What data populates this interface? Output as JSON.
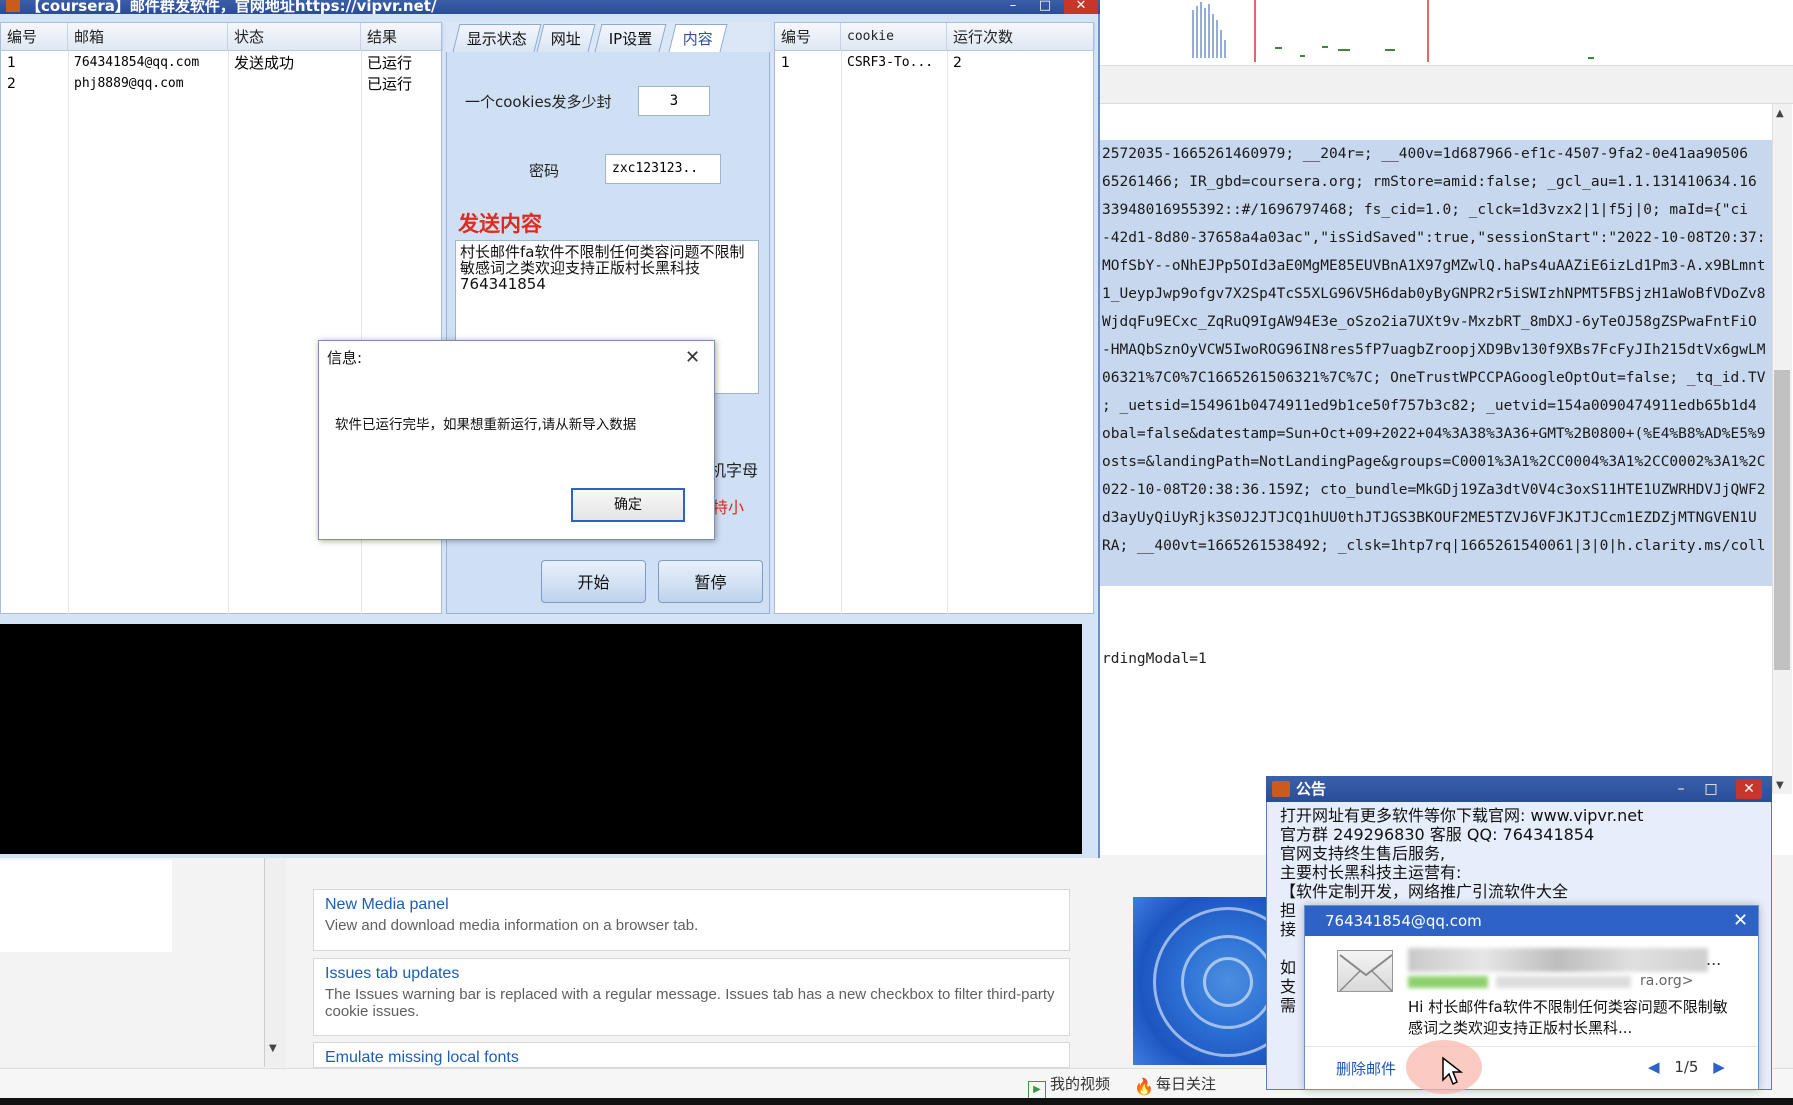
{
  "app": {
    "title": "【coursera】邮件群发软件，官网地址https://vipvr.net/",
    "minimize": "–",
    "maximize": "□",
    "close": "✕"
  },
  "left_table": {
    "headers": [
      "编号",
      "邮箱",
      "状态",
      "结果"
    ],
    "rows": [
      {
        "id": "1",
        "email": "764341854@qq.com",
        "status": "发送成功",
        "result": "已运行"
      },
      {
        "id": "2",
        "email": "phj8889@qq.com",
        "status": "",
        "result": "已运行"
      }
    ]
  },
  "tabs": [
    {
      "label": "显示状态",
      "active": false
    },
    {
      "label": "网址",
      "active": false
    },
    {
      "label": "IP设置",
      "active": false
    },
    {
      "label": "内容",
      "active": true
    }
  ],
  "content_tab": {
    "cookie_count_label": "一个cookies发多少封",
    "cookie_count_value": "3",
    "password_label": "密码",
    "password_value": "zxc123123..",
    "send_content_label": "发送内容",
    "send_content_text": "村长邮件fa软件不限制任何类容问题不限制敏感词之类欢迎支持正版村长黑科技\n764341854",
    "partial_label_1": "机字母",
    "partial_label_2": "特小",
    "start_button": "开始",
    "pause_button": "暂停"
  },
  "right_table": {
    "headers": [
      "编号",
      "cookie",
      "运行次数"
    ],
    "rows": [
      {
        "id": "1",
        "cookie": "CSRF3-To...",
        "count": "2"
      }
    ]
  },
  "modal": {
    "title": "信息:",
    "message": "软件已运行完毕，如果想重新运行,请从新导入数据",
    "ok_button": "确定",
    "close": "✕"
  },
  "cookie_lines": [
    "2572035-1665261460979; __204r=; __400v=1d687966-ef1c-4507-9fa2-0e41aa90506",
    "65261466; IR_gbd=coursera.org; rmStore=amid:false; _gcl_au=1.1.131410634.16",
    "33948016955392::#/1696797468; fs_cid=1.0; _clck=1d3vzx2|1|f5j|0; maId={\"ci",
    "-42d1-8d80-37658a4a03ac\",\"isSidSaved\":true,\"sessionStart\":\"2022-10-08T20:37:",
    "MOfSbY--oNhEJPp5OId3aE0MgME85EUVBnA1X97gMZwlQ.haPs4uAAZiE6izLd1Pm3-A.x9BLmnt",
    "1_UeypJwp9ofgv7X2Sp4TcS5XLG96V5H6dab0yByGNPR2r5iSWIzhNPMT5FBSjzH1aWoBfVDoZv8",
    "WjdqFu9ECxc_ZqRuQ9IgAW94E3e_oSzo2ia7UXt9v-MxzbRT_8mDXJ-6yTeOJ58gZSPwaFntFiO",
    "-HMAQbSznOyVCW5IwoROG96IN8res5fP7uagbZroopjXD9Bv130f9XBs7FcFyJIh215dtVx6gwLM",
    "06321%7C0%7C1665261506321%7C%7C; OneTrustWPCCPAGoogleOptOut=false; _tq_id.TV",
    "; _uetsid=154961b0474911ed9b1ce50f757b3c82; _uetvid=154a0090474911edb65b1d4",
    "obal=false&datestamp=Sun+Oct+09+2022+04%3A38%3A36+GMT%2B0800+(%E4%B8%AD%E5%9",
    "osts=&landingPath=NotLandingPage&groups=C0001%3A1%2CC0004%3A1%2CC0002%3A1%2C",
    "022-10-08T20:38:36.159Z; cto_bundle=MkGDj19Za3dtV0V4c3oxS11HTE1UZWRHDVJjQWF2",
    "d3ayUyQiUyRjk3S0J2JTJCQ1hUU0thJTJGS3BKOUF2ME5TZVJ6VFJKJTJCcm1EZDZjMTNGVEN1U",
    "RA; __400vt=1665261538492; _clsk=1htp7rq|1665261540061|3|0|h.clarity.ms/coll"
  ],
  "after_cookie_text": "rdingModal=1",
  "devtools_panels": [
    {
      "title": "New Media panel",
      "desc": "View and download media information on a browser tab."
    },
    {
      "title": "Issues tab updates",
      "desc": "The Issues warning bar is replaced with a regular message. Issues tab has a new checkbox to filter third-party cookie issues."
    },
    {
      "title": "Emulate missing local fonts",
      "desc": ""
    }
  ],
  "taskbar": {
    "my_videos": "我的视频",
    "daily_follow": "每日关注"
  },
  "announcement": {
    "title": "公告",
    "lines": [
      "打开网址有更多软件等你下载官网: www.vipvr.net",
      "  官方群 249296830   客服 QQ: 764341854",
      "   官网支持终生售后服务,",
      "主要村长黑科技主运营有:",
      "【软件定制开发，网络推广引流软件大全",
      "担",
      "接",
      "",
      "  如",
      "支",
      "  需"
    ]
  },
  "mail_notification": {
    "from": "764341854@qq.com",
    "from_suffix": "ra.org>",
    "ellipsis": "...",
    "body": "Hi 村长邮件fa软件不限制任何类容问题不限制敏感词之类欢迎支持正版村长黑科...",
    "delete_label": "删除邮件",
    "pager": "1/5",
    "close": "✕"
  },
  "colors": {
    "accent_blue": "#2e63c5",
    "title_bar": "#2a4c97",
    "close_red": "#c7362a",
    "send_red": "#e02b1c",
    "cookie_highlight": "#c7d8ee"
  }
}
